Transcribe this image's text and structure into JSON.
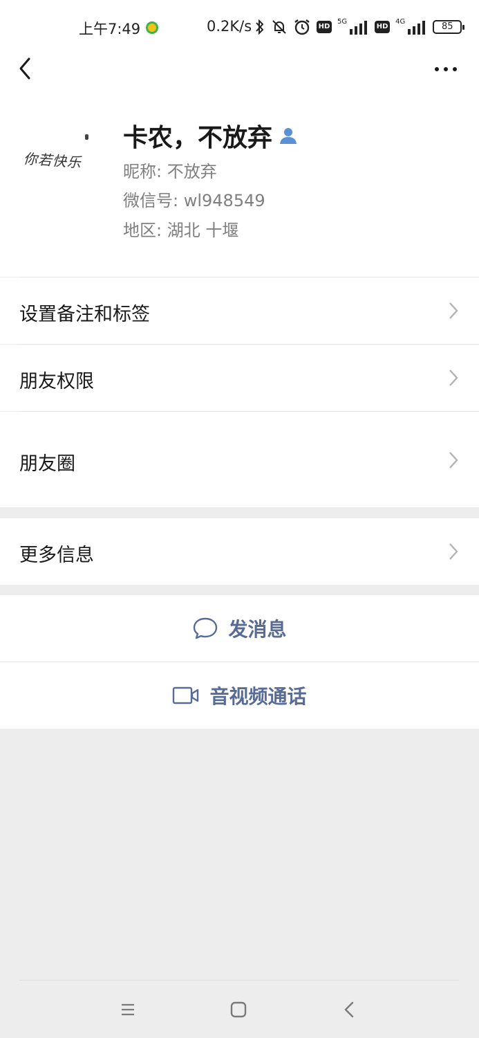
{
  "status_bar": {
    "time": "上午7:49",
    "network_speed": "0.2K/s",
    "signal_label_1": "5G",
    "signal_label_2": "4G",
    "hd_label": "HD",
    "battery": "85"
  },
  "profile": {
    "avatar_text": "你若快乐",
    "display_name": "卡农，不放弃",
    "nickname": "昵称:  不放弃",
    "wechat_id": "微信号:  wl948549",
    "region": "地区:  湖北  十堰"
  },
  "menu": {
    "remark_tags": "设置备注和标签",
    "friend_permissions": "朋友权限",
    "moments": "朋友圈",
    "more_info": "更多信息"
  },
  "actions": {
    "send_message": "发消息",
    "video_call": "音视频通话"
  },
  "colors": {
    "accent_link": "#576b95",
    "person_icon": "#5b8fd6",
    "background": "#ededed"
  }
}
